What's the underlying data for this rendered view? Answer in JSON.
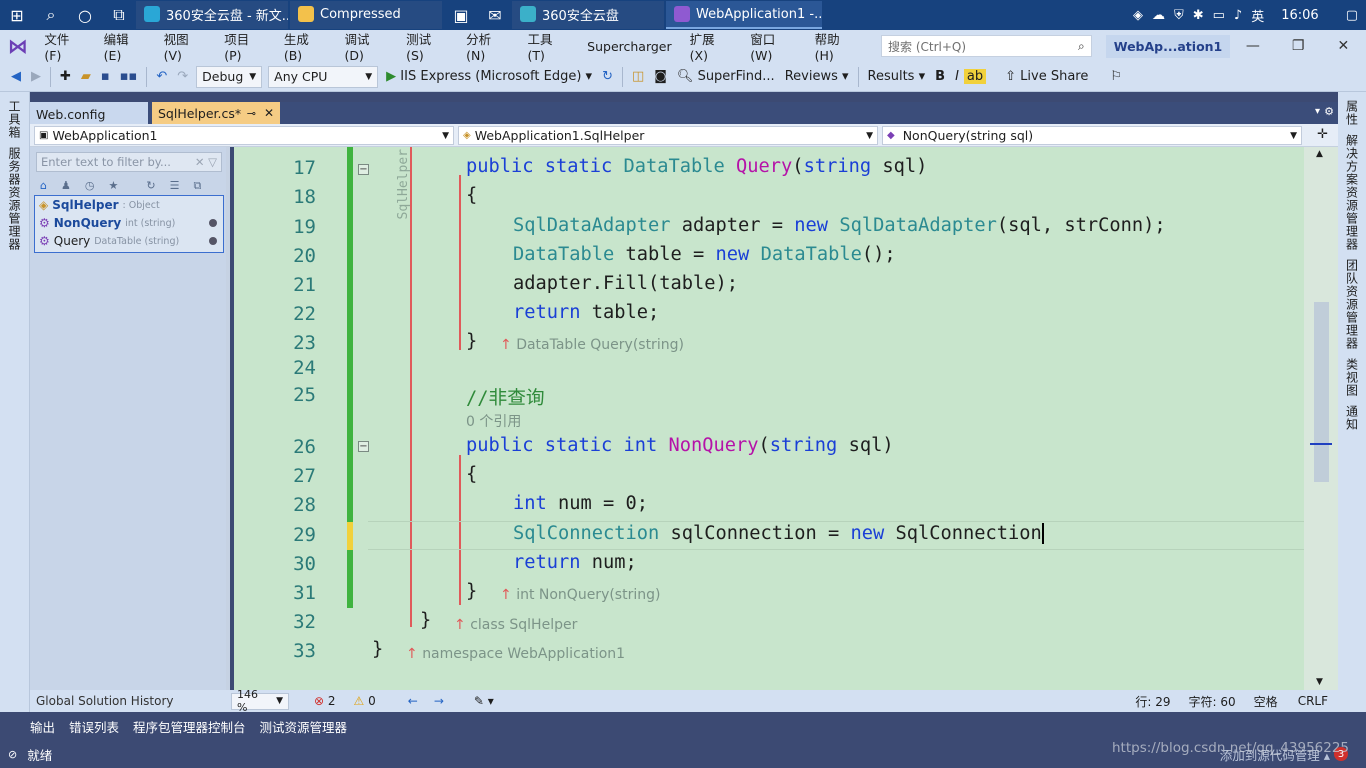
{
  "taskbar": {
    "tasks": [
      "360安全云盘 - 新文...",
      "Compressed",
      "360安全云盘",
      "WebApplication1 -..."
    ],
    "ime": "英",
    "time": "16:06"
  },
  "menu": {
    "items": [
      "文件(F)",
      "编辑(E)",
      "视图(V)",
      "项目(P)",
      "生成(B)",
      "调试(D)",
      "测试(S)",
      "分析(N)",
      "工具(T)",
      "Supercharger",
      "扩展(X)",
      "窗口(W)",
      "帮助(H)"
    ],
    "search_placeholder": "搜索 (Ctrl+Q)",
    "window_title": "WebAp...ation1"
  },
  "toolbar": {
    "config": "Debug",
    "platform": "Any CPU",
    "run": "IIS Express (Microsoft Edge)",
    "superfind": "SuperFind...",
    "reviews": "Reviews",
    "results": "Results",
    "bold": "B",
    "italic": "I",
    "liveshare": "Live Share"
  },
  "left_rail": {
    "a": "工具箱",
    "b": "服务器资源管理器"
  },
  "right_rail": {
    "a": "属性",
    "b": "解决方案资源管理器",
    "c": "团队资源管理器",
    "d": "类视图",
    "e": "通知"
  },
  "tabs": {
    "tab1": "Web.config",
    "tab2": "SqlHelper.cs*"
  },
  "nav": {
    "project": "WebApplication1",
    "class": "WebApplication1.SqlHelper",
    "member": "NonQuery(string sql)"
  },
  "classview": {
    "filter_placeholder": "Enter text to filter by...",
    "items": [
      {
        "name": "SqlHelper",
        "type": ": Object"
      },
      {
        "name": "NonQuery",
        "type": "int (string)"
      },
      {
        "name": "Query",
        "type": "DataTable (string)"
      }
    ]
  },
  "editor": {
    "side_label": "SqlHelper",
    "lines": {
      "l17": "17",
      "l18": "18",
      "l19": "19",
      "l20": "20",
      "l21": "21",
      "l22": "22",
      "l23": "23",
      "l24": "24",
      "l25": "25",
      "l26": "26",
      "l27": "27",
      "l28": "28",
      "l29": "29",
      "l30": "30",
      "l31": "31",
      "l32": "32",
      "l33": "33"
    },
    "refs_line": "0 个引用",
    "comment": "//非查询",
    "hint23": "DataTable Query(string)",
    "hint31": "int NonQuery(string)",
    "hint32": "class SqlHelper",
    "hint33": "namespace WebApplication1"
  },
  "edstatus": {
    "history": "Global Solution History",
    "zoom": "146 %",
    "errors": "2",
    "warnings": "0",
    "line": "行: 29",
    "col": "字符: 60",
    "spaces": "空格",
    "eol": "CRLF"
  },
  "bottomtabs": [
    "输出",
    "错误列表",
    "程序包管理器控制台",
    "测试资源管理器"
  ],
  "statusbar": {
    "ready": "就绪",
    "scm": "添加到源代码管理",
    "watermark": "https://blog.csdn.net/qq_43956225",
    "badge": "3"
  }
}
